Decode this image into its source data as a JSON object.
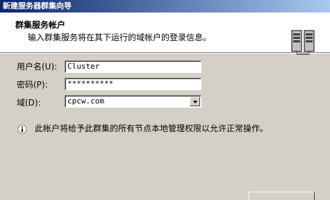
{
  "window": {
    "title": "新建服务器群集向导"
  },
  "header": {
    "title": "群集服务帐户",
    "subtitle": "输入群集服务将在其下运行的域帐户的登录信息。",
    "icon": "cluster-servers-icon"
  },
  "form": {
    "username": {
      "label": "用户名(U):",
      "value": "Cluster"
    },
    "password": {
      "label": "密码(P):",
      "value": "**********"
    },
    "domain": {
      "label": "域(D):",
      "value": "cpcw.com"
    }
  },
  "info": {
    "icon": "info-icon",
    "text": "此帐户将给予此群集的所有节点本地管理权限以允许正常操作。"
  }
}
